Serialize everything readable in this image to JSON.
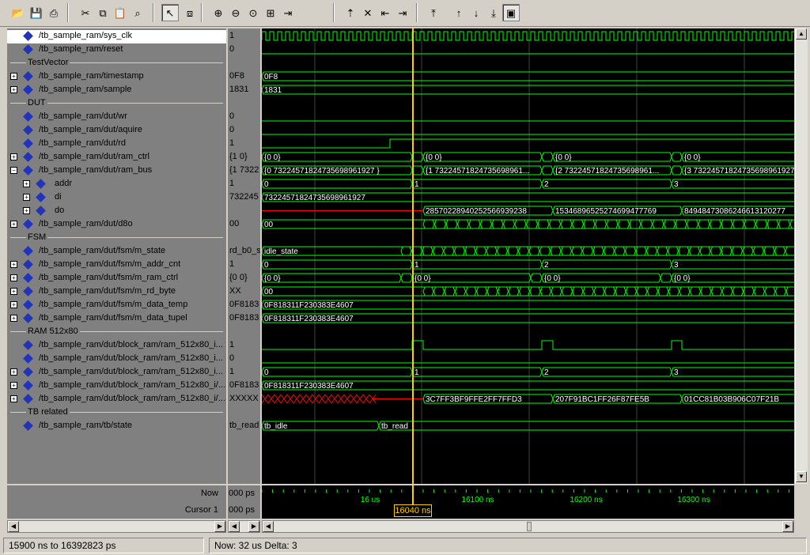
{
  "toolbar": {
    "icons": [
      "open-icon",
      "save-icon",
      "print-icon",
      "cut-icon",
      "copy-icon",
      "paste-icon",
      "find-icon",
      "select-mode-icon",
      "zoom-mode-icon",
      "zoom-in-icon",
      "zoom-out-icon",
      "zoom-fit-icon",
      "zoom-cursor-icon",
      "zoom-range-icon",
      "insert-cursor-icon",
      "delete-cursor-icon",
      "prev-edge-icon",
      "next-edge-icon",
      "find-first-icon",
      "find-prev-icon",
      "find-next-icon",
      "find-last-icon",
      "dock-icon"
    ]
  },
  "signals": [
    {
      "kind": "sig",
      "name": "/tb_sample_ram/sys_clk",
      "value": "1",
      "expand": false
    },
    {
      "kind": "sig",
      "name": "/tb_sample_ram/reset",
      "value": "0",
      "expand": false
    },
    {
      "kind": "div",
      "name": "TestVector"
    },
    {
      "kind": "sig",
      "name": "/tb_sample_ram/timestamp",
      "value": "0F8",
      "expand": true
    },
    {
      "kind": "sig",
      "name": "/tb_sample_ram/sample",
      "value": "1831",
      "expand": true
    },
    {
      "kind": "div",
      "name": "DUT"
    },
    {
      "kind": "sig",
      "name": "/tb_sample_ram/dut/wr",
      "value": "0",
      "expand": false
    },
    {
      "kind": "sig",
      "name": "/tb_sample_ram/dut/aquire",
      "value": "0",
      "expand": false
    },
    {
      "kind": "sig",
      "name": "/tb_sample_ram/dut/rd",
      "value": "1",
      "expand": false
    },
    {
      "kind": "sig",
      "name": "/tb_sample_ram/dut/ram_ctrl",
      "value": "{1 0}",
      "expand": true
    },
    {
      "kind": "sig",
      "name": "/tb_sample_ram/dut/ram_bus",
      "value": "{1 7322",
      "expand": true,
      "open": true
    },
    {
      "kind": "sub",
      "name": "addr",
      "value": "1",
      "expand": true
    },
    {
      "kind": "sub",
      "name": "di",
      "value": "732245",
      "expand": true
    },
    {
      "kind": "sub",
      "name": "do",
      "value": "",
      "expand": true
    },
    {
      "kind": "sig",
      "name": "/tb_sample_ram/dut/d8o",
      "value": "00",
      "expand": true
    },
    {
      "kind": "div",
      "name": "FSM"
    },
    {
      "kind": "sig",
      "name": "/tb_sample_ram/dut/fsm/m_state",
      "value": "rd_b0_s",
      "expand": false
    },
    {
      "kind": "sig",
      "name": "/tb_sample_ram/dut/fsm/m_addr_cnt",
      "value": "1",
      "expand": true
    },
    {
      "kind": "sig",
      "name": "/tb_sample_ram/dut/fsm/m_ram_ctrl",
      "value": "{0 0}",
      "expand": true
    },
    {
      "kind": "sig",
      "name": "/tb_sample_ram/dut/fsm/m_rd_byte",
      "value": "XX",
      "expand": true
    },
    {
      "kind": "sig",
      "name": "/tb_sample_ram/dut/fsm/m_data_temp",
      "value": "0F8183",
      "expand": true
    },
    {
      "kind": "sig",
      "name": "/tb_sample_ram/dut/fsm/m_data_tupel",
      "value": "0F8183",
      "expand": true
    },
    {
      "kind": "div",
      "name": "RAM 512x80"
    },
    {
      "kind": "sig",
      "name": "/tb_sample_ram/dut/block_ram/ram_512x80_i...",
      "value": "1",
      "expand": false
    },
    {
      "kind": "sig",
      "name": "/tb_sample_ram/dut/block_ram/ram_512x80_i...",
      "value": "0",
      "expand": false
    },
    {
      "kind": "sig",
      "name": "/tb_sample_ram/dut/block_ram/ram_512x80_i...",
      "value": "1",
      "expand": true
    },
    {
      "kind": "sig",
      "name": "/tb_sample_ram/dut/block_ram/ram_512x80_i/...",
      "value": "0F8183",
      "expand": true
    },
    {
      "kind": "sig",
      "name": "/tb_sample_ram/dut/block_ram/ram_512x80_i/...",
      "value": "XXXXX",
      "expand": true
    },
    {
      "kind": "div",
      "name": "TB related"
    },
    {
      "kind": "sig",
      "name": "/tb_sample_ram/tb/state",
      "value": "tb_read",
      "expand": false
    }
  ],
  "waves": {
    "timestamp": "0F8",
    "sample": "1831",
    "ram_ctrl": [
      "{0 0}",
      "{0 0}",
      "{0 0}",
      "{0 0}"
    ],
    "ram_bus": [
      "{0 73224571824735698961927 }",
      "{1 73224571824735698961...",
      "{2 73224571824735698961...",
      "{3 73224571824735698961927..."
    ],
    "addr": [
      "0",
      "1",
      "2",
      "3"
    ],
    "di": "73224571824735698961927",
    "do": [
      "28570228940252566939238",
      "15346896525274699477769",
      "84948473086246613120277"
    ],
    "d8o": "00",
    "m_state": "idle_state",
    "m_addr_cnt": [
      "0",
      "1",
      "2",
      "3"
    ],
    "m_ram_ctrl": [
      "{0 0}",
      "{0 0}",
      "{0 0}",
      "{0 0}"
    ],
    "m_rd_byte": "00",
    "m_data_temp": "0F818311F230383E4607",
    "m_data_tupel": "0F818311F230383E4607",
    "ram_addr": [
      "0",
      "1",
      "2",
      "3"
    ],
    "ram_di": "0F818311F230383E4607",
    "ram_do": [
      "3C7FF3BF9FFE2FF7FFD3",
      "207F91BC1FF26F87FE5B",
      "01CC81B03B906C07F21B"
    ],
    "tb_state": [
      "tb_idle",
      "tb_read"
    ]
  },
  "now": {
    "label": "Now",
    "value": "000 ps"
  },
  "cursor": {
    "label": "Cursor 1",
    "value": "000 ps",
    "time": "16040 ns"
  },
  "timeline": {
    "ticks": [
      "16 us",
      "16100 ns",
      "16200 ns",
      "16300 ns"
    ]
  },
  "status": {
    "range": "15900 ns to 16392823 ps",
    "now": "Now: 32 us   Delta: 3"
  },
  "colors": {
    "wave": "#00ff00",
    "cursor": "#ffd000",
    "unknown": "#ff0000",
    "grid": "#404040"
  }
}
